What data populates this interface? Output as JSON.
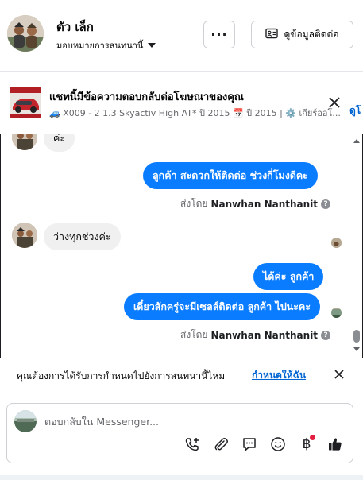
{
  "header": {
    "contact_name": "ตัว เล็ก",
    "assign_label": "มอบหมายการสนทนานี้",
    "more_label": "···",
    "view_info_label": "ดูข้อมูลติดต่อ"
  },
  "ad_banner": {
    "title": "แชทนี้มีข้อความตอบกลับต่อโฆษณาของคุณ",
    "subtitle": "🚙 X009 - 2 1.3 Skyactiv High AT* ปี 2015 📅 ปี 2015 | ⚙️ เกียร์ออโ...",
    "link_label": "ดูโ"
  },
  "messages": [
    {
      "direction": "in",
      "text": "ค่ะ"
    },
    {
      "direction": "out",
      "text": "ลูกค้า  สะดวกให้ติดต่อ ช่วงกี่โมงดีคะ"
    },
    {
      "direction": "meta",
      "prefix": "ส่งโดย",
      "author": "Nanwhan Nanthanit"
    },
    {
      "direction": "in",
      "text": "ว่างทุกช่วงค่ะ"
    },
    {
      "direction": "out",
      "text": "ได้ค่ะ  ลูกค้า"
    },
    {
      "direction": "out",
      "text": "เดี๋ยวสักครู่จะมีเซลล์ติดต่อ ลูกค้า ไปนะคะ"
    },
    {
      "direction": "meta",
      "prefix": "ส่งโดย",
      "author": "Nanwhan Nanthanit"
    }
  ],
  "assign_prompt": {
    "text": "คุณต้องการได้รับการกำหนดไปยังการสนทนานี้ไหม",
    "link_label": "กำหนดให้ฉัน"
  },
  "composer": {
    "placeholder": "ตอบกลับใน Messenger...",
    "tools": [
      "call-add-icon",
      "attachment-icon",
      "saved-reply-icon",
      "emoji-icon",
      "baht-icon",
      "like-icon"
    ],
    "baht_symbol": "฿"
  },
  "colors": {
    "outgoing_bubble": "#0a7cff",
    "incoming_bubble": "#f0f0f0",
    "link": "#0064d1"
  }
}
